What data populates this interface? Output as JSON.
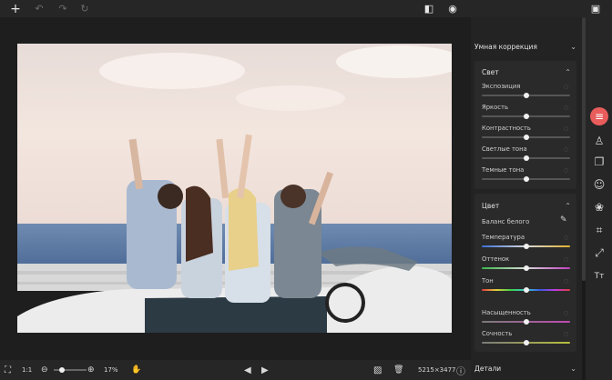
{
  "toolbar": {
    "add_icon": "+",
    "undo_icon": "↶",
    "redo_icon": "↷",
    "reset_icon": "↻",
    "compare_icon": "◧",
    "preview_icon": "◉",
    "save_icon": "▣"
  },
  "panel": {
    "smart_correction": "Умная коррекция",
    "light": {
      "title": "Свет",
      "sliders": [
        {
          "label": "Экспозиция",
          "value": 0
        },
        {
          "label": "Яркость",
          "value": 0
        },
        {
          "label": "Контрастность",
          "value": 0
        },
        {
          "label": "Светлые тона",
          "value": 0
        },
        {
          "label": "Темные тона",
          "value": 0
        }
      ]
    },
    "color": {
      "title": "Цвет",
      "white_balance": "Баланс белого",
      "sliders": [
        {
          "label": "Температура",
          "value": 0
        },
        {
          "label": "Оттенок",
          "value": 0
        },
        {
          "label": "Тон",
          "value": 0
        },
        {
          "label": "Насыщенность",
          "value": 0
        },
        {
          "label": "Сочность",
          "value": 0
        }
      ]
    },
    "details": "Детали"
  },
  "tools": [
    "adjust-icon",
    "stamp-icon",
    "layers-icon",
    "face-icon",
    "color-icon",
    "crop-icon",
    "resize-icon",
    "text-icon"
  ],
  "tool_glyphs": [
    "≡",
    "♙",
    "❐",
    "☺",
    "❀",
    "⌗",
    "⤢",
    "Tт"
  ],
  "bottom": {
    "fit_icon": "⛶",
    "ratio": "1:1",
    "zoom_out_icon": "⊖",
    "zoom_in_icon": "⊕",
    "zoom_value": "17%",
    "zoom_fraction": 0.17,
    "hand_icon": "✋",
    "prev_icon": "◀",
    "next_icon": "▶",
    "image_icon": "▨",
    "trash_icon": "🗑",
    "dimensions": "5215×3477",
    "info_icon": "ⓘ"
  },
  "colors": {
    "accent": "#e85c5c",
    "panel_bg": "#232323",
    "group_bg": "#2a2a2a"
  }
}
